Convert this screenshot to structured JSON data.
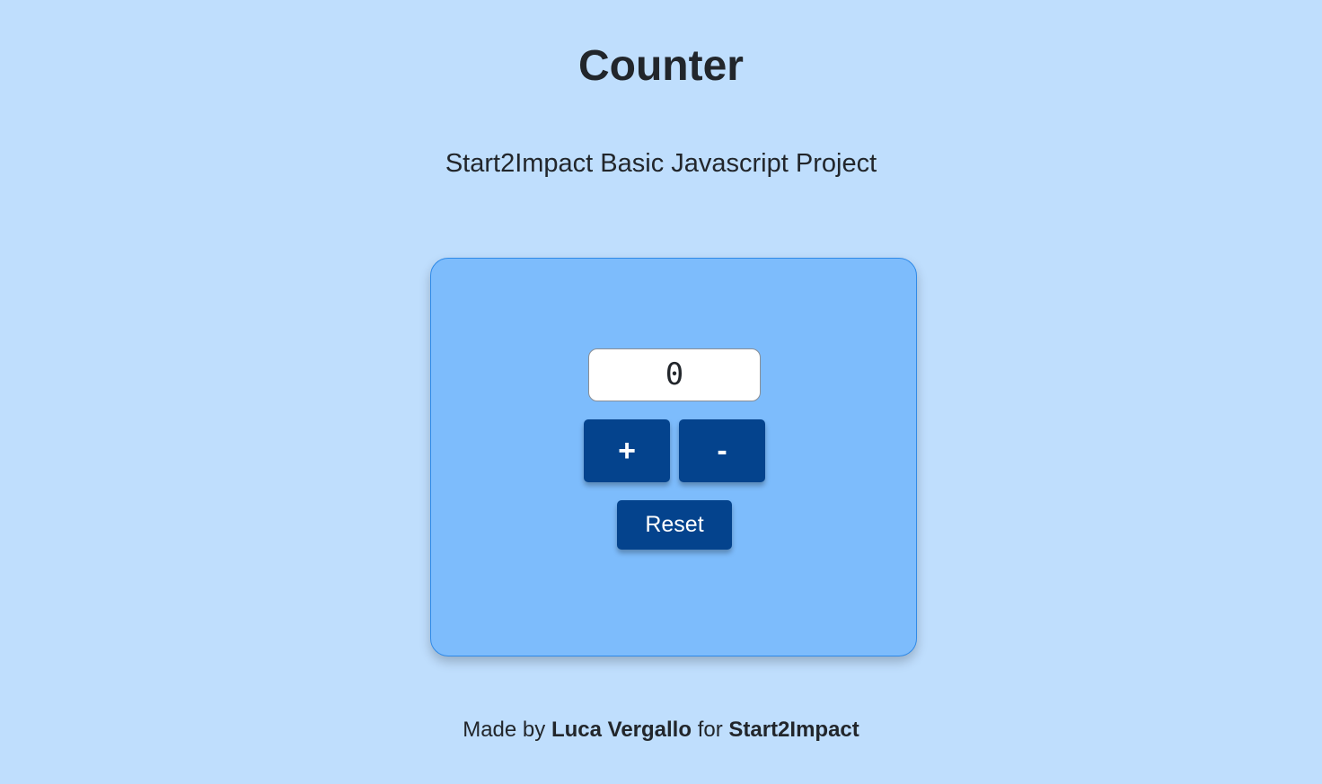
{
  "header": {
    "title": "Counter",
    "subtitle": "Start2Impact Basic Javascript Project"
  },
  "counter": {
    "value": "0",
    "increment_label": "+",
    "decrement_label": "-",
    "reset_label": "Reset"
  },
  "footer": {
    "made_by_prefix": "Made by",
    "author": "Luca Vergallo",
    "for_word": "for",
    "organization": "Start2Impact"
  },
  "colors": {
    "page_background": "#bfdefd",
    "card_background": "#7dbcfc",
    "card_border": "#2f8ae8",
    "button_background": "#04438d",
    "button_text": "#ffffff",
    "text": "#22262b"
  }
}
